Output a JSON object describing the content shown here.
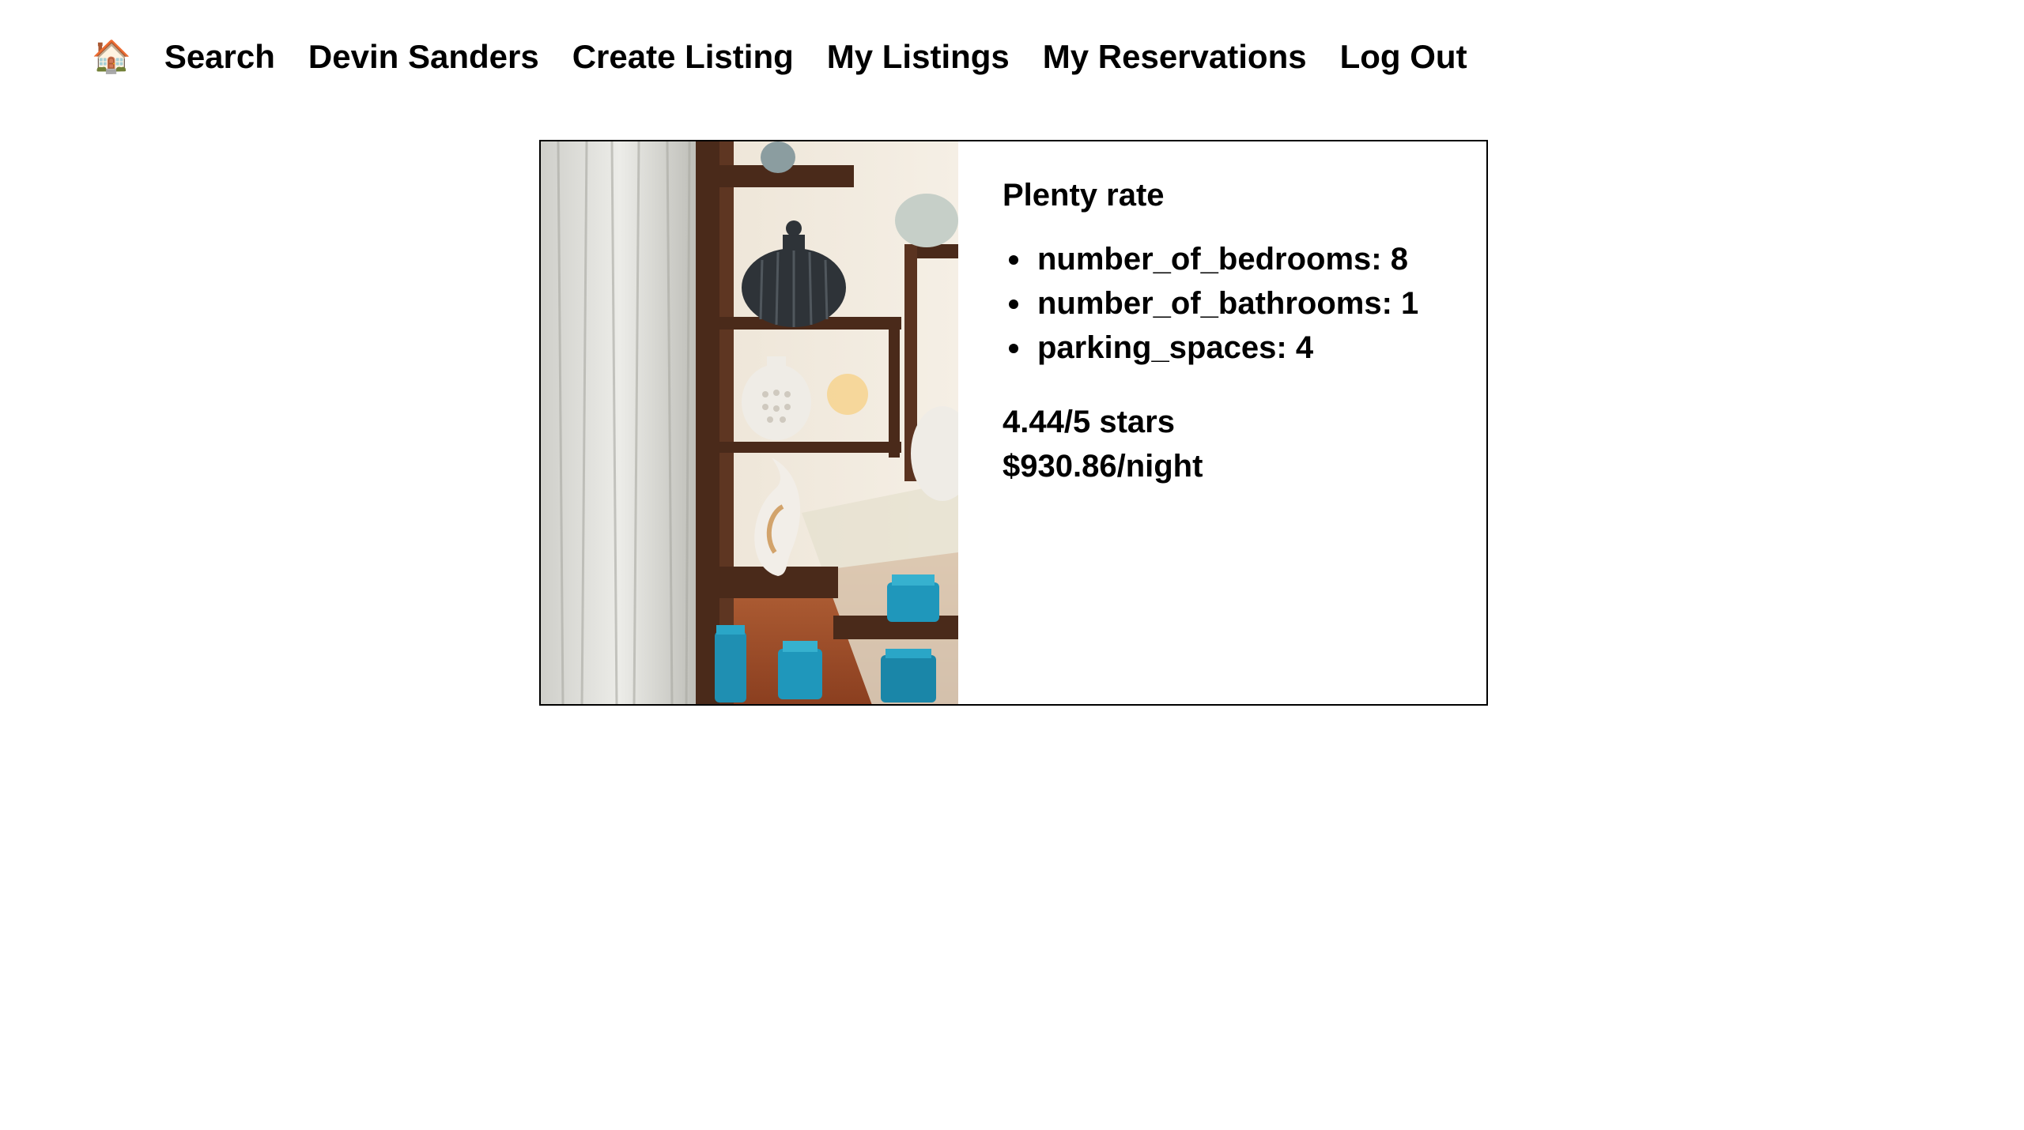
{
  "nav": {
    "home_icon": "🏠",
    "home_icon_name": "house-icon",
    "links": [
      "Search",
      "Devin Sanders",
      "Create Listing",
      "My Listings",
      "My Reservations",
      "Log Out"
    ]
  },
  "listing": {
    "title": "Plenty rate",
    "features": [
      "number_of_bedrooms: 8",
      "number_of_bathrooms: 1",
      "parking_spaces: 4"
    ],
    "rating": "4.44/5 stars",
    "price": "$930.86/night"
  }
}
